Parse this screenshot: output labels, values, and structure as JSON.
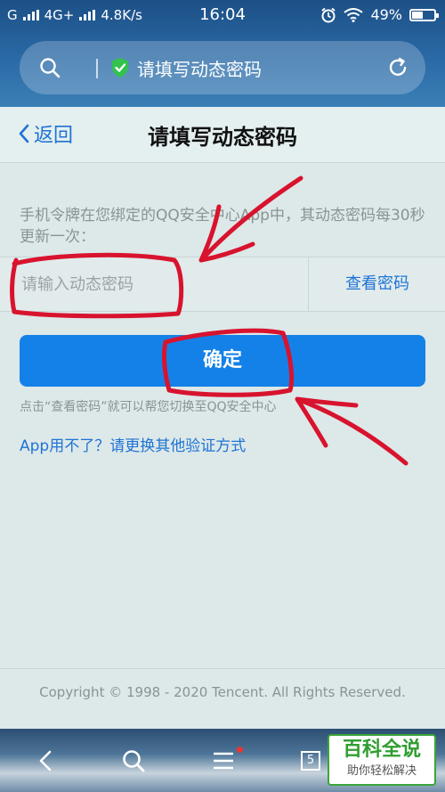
{
  "status_bar": {
    "carrier_left": "G",
    "network": "4G+",
    "speed": "4.8K/s",
    "time": "16:04",
    "battery": "49%",
    "battery_level": 0.49
  },
  "browser": {
    "address_title": "请填写动态密码"
  },
  "header": {
    "back_label": "返回",
    "title": "请填写动态密码"
  },
  "form": {
    "description": "手机令牌在您绑定的QQ安全中心App中，其动态密码每30秒更新一次：",
    "input_placeholder": "请输入动态密码",
    "input_value": "",
    "view_password_label": "查看密码",
    "confirm_label": "确定",
    "hint": "点击“查看密码”就可以帮您切换至QQ安全中心",
    "alt_link": "App用不了？请更换其他验证方式"
  },
  "footer": {
    "copyright": "Copyright © 1998 - 2020 Tencent. All Rights Reserved."
  },
  "bottom_nav": {
    "tabs_count": "5"
  },
  "watermark": {
    "line1": "百科全说",
    "line2": "助你轻松解决"
  },
  "colors": {
    "accent": "#1481e8",
    "link": "#1e73d6",
    "annotation": "#d8132e",
    "shield": "#32c24d"
  }
}
